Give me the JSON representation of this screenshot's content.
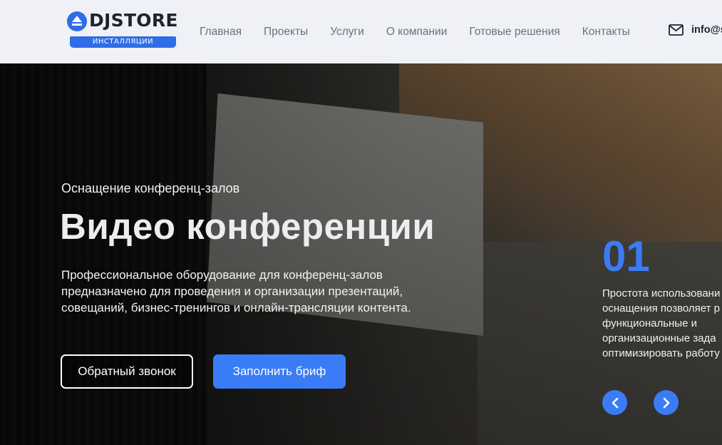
{
  "header": {
    "logo_text": "DJSTORE",
    "logo_badge": "ИНСТАЛЛЯЦИИ",
    "nav": [
      "Главная",
      "Проекты",
      "Услуги",
      "О компании",
      "Готовые решения",
      "Контакты"
    ],
    "email": "info@s"
  },
  "hero": {
    "subtitle": "Оснащение конференц-залов",
    "title": "Видео конференции",
    "description": "Профессиональное оборудование для конференц-залов предназначено для проведения и организации презентаций, совещаний, бизнес-тренингов и онлайн-трансляции контента.",
    "callback_button": "Обратный звонок",
    "brief_button": "Заполнить бриф"
  },
  "slide": {
    "number": "01",
    "lines": [
      "Простота использовани",
      "оснащения позволяет р",
      "функциональные и",
      "организационные зада",
      "оптимизировать работу"
    ]
  },
  "colors": {
    "accent": "#3a7cf5",
    "header_bg": "#eff1f6",
    "logo_blue": "#2f6de6"
  },
  "icons": {
    "mail": "mail-icon",
    "prev": "chevron-left-icon",
    "next": "chevron-right-icon"
  }
}
